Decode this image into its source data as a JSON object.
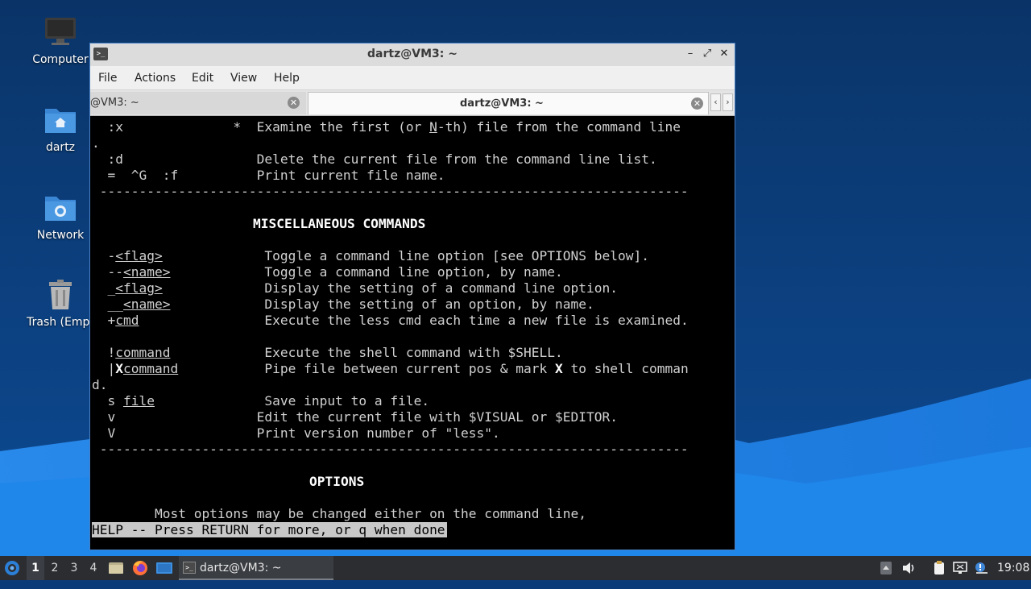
{
  "desktop": {
    "icons": [
      {
        "label": "Computer",
        "icon": "computer-icon"
      },
      {
        "label": "dartz",
        "icon": "home-folder-icon"
      },
      {
        "label": "Network",
        "icon": "network-folder-icon"
      },
      {
        "label": "Trash (Empt",
        "icon": "trash-icon"
      }
    ]
  },
  "window": {
    "title": "dartz@VM3: ~",
    "controls": {
      "minimize": "–",
      "maximize": "⤢",
      "close": "✕"
    },
    "menu": [
      "File",
      "Actions",
      "Edit",
      "View",
      "Help"
    ],
    "tabs": [
      {
        "label": "@VM3: ~",
        "active": false
      },
      {
        "label": "dartz@VM3: ~",
        "active": true
      }
    ]
  },
  "terminal": {
    "lines": {
      "l1a": "  :x              *  Examine the first (or ",
      "l1n": "N",
      "l1b": "-th) file from the command line",
      "l2": ".",
      "l3": "  :d                 Delete the current file from the command line list.",
      "l4": "  =  ^G  :f          Print current file name.",
      "sep1": " ---------------------------------------------------------------------------",
      "heading1": "MISCELLANEOUS COMMANDS",
      "r1a": "  -",
      "r1u": "<flag>",
      "r1b": "             Toggle a command line option [see OPTIONS below].",
      "r2a": "  --",
      "r2u": "<name>",
      "r2b": "            Toggle a command line option, by name.",
      "r3a": "  _",
      "r3u": "<flag>",
      "r3b": "             Display the setting of a command line option.",
      "r4a": "  __",
      "r4u": "<name>",
      "r4b": "            Display the setting of an option, by name.",
      "r5a": "  +",
      "r5u": "cmd",
      "r5b": "                Execute the less cmd each time a new file is examined.",
      "r6a": "  !",
      "r6u": "command",
      "r6b": "            Execute the shell command with $SHELL.",
      "r7a": "  |",
      "r7x": "X",
      "r7u": "command",
      "r7b": "           Pipe file between current pos & mark ",
      "r7x2": "X",
      "r7c": " to shell comman",
      "r7wrap": "d.",
      "r8a": "  s ",
      "r8u": "file",
      "r8b": "              Save input to a file.",
      "r9": "  v                  Edit the current file with $VISUAL or $EDITOR.",
      "r10": "  V                  Print version number of \"less\".",
      "sep2": " ---------------------------------------------------------------------------",
      "heading2": "OPTIONS",
      "opt1": "        Most options may be changed either on the command line,"
    },
    "status": "HELP -- Press RETURN for more, or q when done"
  },
  "taskbar": {
    "workspaces": [
      "1",
      "2",
      "3",
      "4"
    ],
    "active_workspace": "1",
    "task_label": "dartz@VM3: ~",
    "clock": "19:08"
  }
}
